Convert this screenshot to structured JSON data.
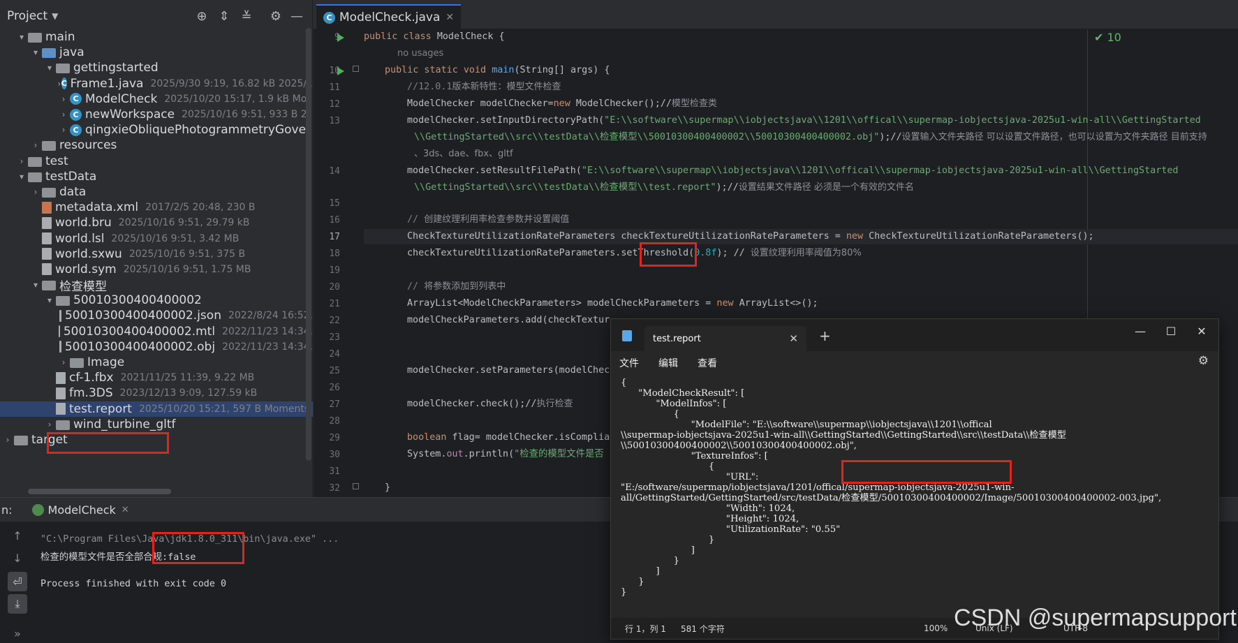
{
  "project": {
    "title": "Project",
    "tree": [
      {
        "label": "main",
        "meta": "",
        "type": "folder",
        "arrow": "▾"
      },
      {
        "label": "java",
        "meta": "",
        "type": "folder-blue",
        "arrow": "▾"
      },
      {
        "label": "gettingstarted",
        "meta": "",
        "type": "folder",
        "arrow": "▾"
      },
      {
        "label": "Frame1.java",
        "meta": "2025/9/30 9:19, 16.82 kB 2025/1",
        "type": "java",
        "arrow": "›"
      },
      {
        "label": "ModelCheck",
        "meta": "2025/10/20 15:17, 1.9 kB Mo",
        "type": "java",
        "arrow": "›"
      },
      {
        "label": "newWorkspace",
        "meta": "2025/10/16 9:51, 933 B 2",
        "type": "java",
        "arrow": "›"
      },
      {
        "label": "qingxieObliquePhotogrammetryGover",
        "meta": "",
        "type": "java",
        "arrow": "›"
      },
      {
        "label": "resources",
        "meta": "",
        "type": "folder",
        "arrow": "›"
      },
      {
        "label": "test",
        "meta": "",
        "type": "folder",
        "arrow": "›"
      },
      {
        "label": "testData",
        "meta": "",
        "type": "folder",
        "arrow": "▾"
      },
      {
        "label": "data",
        "meta": "",
        "type": "folder",
        "arrow": "›"
      },
      {
        "label": "metadata.xml",
        "meta": "2017/2/5 20:48, 230 B",
        "type": "xml",
        "arrow": ""
      },
      {
        "label": "world.bru",
        "meta": "2025/10/16 9:51, 29.79 kB",
        "type": "file",
        "arrow": ""
      },
      {
        "label": "world.lsl",
        "meta": "2025/10/16 9:51, 3.42 MB",
        "type": "file",
        "arrow": ""
      },
      {
        "label": "world.sxwu",
        "meta": "2025/10/16 9:51, 375 B",
        "type": "file",
        "arrow": ""
      },
      {
        "label": "world.sym",
        "meta": "2025/10/16 9:51, 1.75 MB",
        "type": "file",
        "arrow": ""
      },
      {
        "label": "检查模型",
        "meta": "",
        "type": "folder",
        "arrow": "▾"
      },
      {
        "label": "50010300400400002",
        "meta": "",
        "type": "folder",
        "arrow": "▾"
      },
      {
        "label": "50010300400400002.json",
        "meta": "2022/8/24 16:52,",
        "type": "file",
        "arrow": ""
      },
      {
        "label": "50010300400400002.mtl",
        "meta": "2022/11/23 14:34,",
        "type": "file",
        "arrow": ""
      },
      {
        "label": "50010300400400002.obj",
        "meta": "2022/11/23 14:34,",
        "type": "file",
        "arrow": ""
      },
      {
        "label": "Image",
        "meta": "",
        "type": "folder",
        "arrow": "›"
      },
      {
        "label": "cf-1.fbx",
        "meta": "2021/11/25 11:39, 9.22 MB",
        "type": "file",
        "arrow": ""
      },
      {
        "label": "fm.3DS",
        "meta": "2023/12/13 9:09, 127.59 kB",
        "type": "file",
        "arrow": ""
      },
      {
        "label": "test.report",
        "meta": "2025/10/20 15:21, 597 B Moments",
        "type": "file",
        "arrow": ""
      },
      {
        "label": "wind_turbine_gltf",
        "meta": "",
        "type": "folder",
        "arrow": "›"
      },
      {
        "label": "target",
        "meta": "",
        "type": "folder",
        "arrow": "›"
      }
    ]
  },
  "editor": {
    "tab_label": "ModelCheck.java",
    "check_count": "10",
    "line_numbers": [
      "9",
      "",
      "10",
      "11",
      "12",
      "13",
      "",
      "",
      "14",
      "",
      "15",
      "16",
      "17",
      "18",
      "19",
      "20",
      "21",
      "22",
      "23",
      "24",
      "25",
      "26",
      "27",
      "28",
      "29",
      "30",
      "31",
      "32"
    ],
    "code": {
      "l9a": "public class ",
      "l9b": "ModelCheck {",
      "usages": "no usages",
      "l10a": "public static void ",
      "l10b": "main",
      "l10c": "(String[] args) {",
      "l11a": "//12.0.1",
      "l11b": "版本新特性：模型文件检查",
      "l12a": "ModelChecker modelChecker=",
      "l12b": "new ",
      "l12c": "ModelChecker();//",
      "l12d": "模型检查类",
      "l13a": "modelChecker.setInputDirectoryPath(",
      "l13b": "\"E:\\\\software\\\\supermap\\\\iobjectsjava\\\\1201\\\\offical\\\\supermap-iobjectsjava-2025u1-win-all\\\\GettingStarted",
      "l13c": "\\\\GettingStarted\\\\src\\\\testData\\\\检查模型\\\\50010300400400002\\\\50010300400400002.obj\"",
      "l13d": ");//",
      "l13e": "设置输入文件夹路径 可以设置文件路径，也可以设置为文件夹路径 目前支持",
      "l13f": "、3ds、dae、fbx、gltf",
      "l14a": "modelChecker.setResultFilePath(",
      "l14b": "\"E:\\\\software\\\\supermap\\\\iobjectsjava\\\\1201\\\\offical\\\\supermap-iobjectsjava-2025u1-win-all\\\\GettingStarted",
      "l14c": "\\\\GettingStarted\\\\src\\\\testData\\\\检查模型\\\\test.report\"",
      "l14d": ");//",
      "l14e": "设置结果文件路径 必须是一个有效的文件名",
      "l16a": "// ",
      "l16b": "创建纹理利用率检查参数并设置阈值",
      "l17a": "CheckTextureUtilizationRateParameters ",
      "l17b": "checkTextureUtilizationRateParameters",
      "l17c": " = ",
      "l17d": "new ",
      "l17e": "CheckTextureUtilizationRateParameters();",
      "l18a": "checkTextureUtilizationRateParameters",
      "l18b": ".setThreshold(",
      "l18c": "0.8f",
      "l18d": "); // ",
      "l18e": "设置纹理利用率阈值为80%",
      "l20a": "// ",
      "l20b": "将参数添加到列表中",
      "l21a": "ArrayList<ModelCheckParameters> modelCheckParameters = ",
      "l21b": "new ",
      "l21c": "ArrayList<>();",
      "l22a": "modelCheckParameters.add(",
      "l22b": "checkTextur",
      "l25": "modelChecker.setParameters(modelChec",
      "l27a": "modelChecker.check();//",
      "l27b": "执行检查",
      "l29a": "boolean ",
      "l29b": "flag= modelChecker.isComplia",
      "l30a": "System.",
      "l30b": "out",
      "l30c": ".println(",
      "l30d": "\"检查的模型文件是否",
      "l32": "}"
    }
  },
  "run": {
    "label": "n:",
    "tab_label": "ModelCheck",
    "command": "\"C:\\Program Files\\Java\\jdk1.8.0_311\\bin\\java.exe\" ...",
    "output_line": "检查的模型文件是否全部合规:false",
    "exit_line": "Process finished with exit code 0"
  },
  "notepad": {
    "tab_title": "test.report",
    "menu": [
      "文件",
      "编辑",
      "查看"
    ],
    "content": "{\n\t\"ModelCheckResult\": [\n\t\t\"ModelInfos\": [\n\t\t\t{\n\t\t\t\t\"ModelFile\": \"E:\\\\software\\\\supermap\\\\iobjectsjava\\\\1201\\\\offical\n\\\\supermap-iobjectsjava-2025u1-win-all\\\\GettingStarted\\\\GettingStarted\\\\src\\\\testData\\\\检查模型\n\\\\50010300400400002\\\\50010300400400002.obj\",\n\t\t\t\t\"TextureInfos\": [\n\t\t\t\t\t{\n\t\t\t\t\t\t\"URL\":\n\"E:/software/supermap/iobjectsjava/1201/offical/supermap-iobjectsjava-2025u1-win-\nall/GettingStarted/GettingStarted/src/testData/检查模型/50010300400400002/Image/50010300400400002-003.jpg\",\n\t\t\t\t\t\t\"Width\": 1024,\n\t\t\t\t\t\t\"Height\": 1024,\n\t\t\t\t\t\t\"UtilizationRate\": \"0.55\"\n\t\t\t\t\t}\n\t\t\t\t]\n\t\t\t}\n\t\t]\n\t}\n}",
    "status": {
      "position": "行 1，列 1",
      "chars": "581 个字符",
      "zoom": "100%",
      "eol": "Unix (LF)",
      "encoding": "UTF-8"
    }
  },
  "watermark": "CSDN @supermapsupport"
}
